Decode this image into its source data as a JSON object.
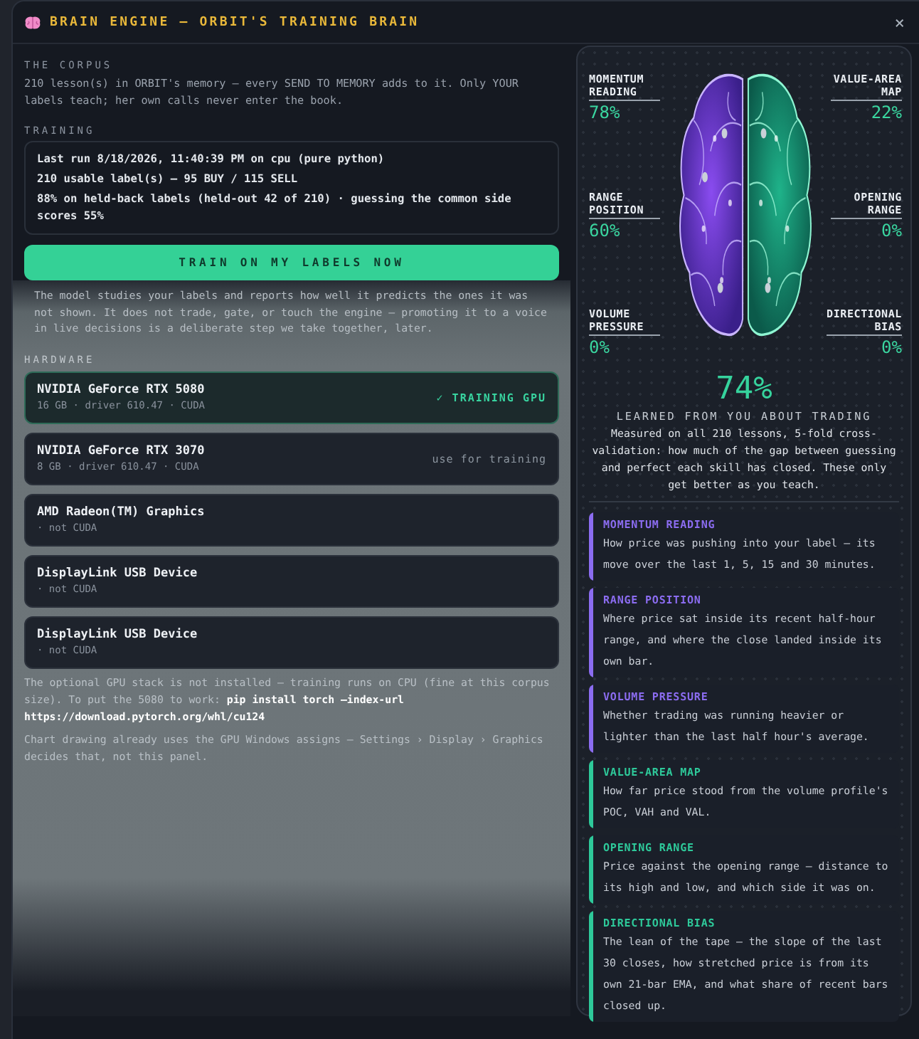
{
  "window": {
    "title": "BRAIN ENGINE — ORBIT'S TRAINING BRAIN",
    "close": "×"
  },
  "corpus": {
    "heading": "THE CORPUS",
    "text": "210 lesson(s) in ORBIT's memory — every SEND TO MEMORY adds to it. Only YOUR labels teach; her own calls never enter the book."
  },
  "training": {
    "heading": "TRAINING",
    "lines": [
      "Last run 8/18/2026, 11:40:39 PM on cpu (pure python)",
      "210 usable label(s) — 95 BUY / 115 SELL",
      "88% on held-back labels (held-out 42 of 210) · guessing the common side scores 55%"
    ],
    "button": "TRAIN ON MY LABELS NOW",
    "note": "The model studies your labels and reports how well it predicts the ones it was not shown. It does not trade, gate, or touch the engine — promoting it to a voice in live decisions is a deliberate step we take together, later."
  },
  "hardware": {
    "heading": "HARDWARE",
    "devices": [
      {
        "name": "NVIDIA GeForce RTX 5080",
        "detail": "16 GB · driver 610.47 · CUDA",
        "action": "✓ TRAINING GPU",
        "selected": true
      },
      {
        "name": "NVIDIA GeForce RTX 3070",
        "detail": "8 GB · driver 610.47 · CUDA",
        "action": "use for training",
        "selected": false
      },
      {
        "name": "AMD Radeon(TM) Graphics",
        "detail": "· not CUDA",
        "selected": false
      },
      {
        "name": "DisplayLink USB Device",
        "detail": "· not CUDA",
        "selected": false
      },
      {
        "name": "DisplayLink USB Device",
        "detail": "· not CUDA",
        "selected": false
      }
    ],
    "note": "The optional GPU stack is not installed — training runs on CPU (fine at this corpus size). To put the 5080 to work: **pip install torch —index-url https://download.pytorch.org/whl/cu124**",
    "note_2": "Chart drawing already uses the GPU Windows assigns — Settings › Display › Graphics decides that, not this panel."
  },
  "brain": {
    "regions": [
      {
        "name": "MOMENTUM READING",
        "reading": "78%"
      },
      {
        "name": "VALUE-AREA MAP",
        "reading": "22%"
      },
      {
        "name": "RANGE POSITION",
        "reading": "60%"
      },
      {
        "name": "OPENING RANGE",
        "reading": "0%"
      },
      {
        "name": "VOLUME PRESSURE",
        "reading": "0%"
      },
      {
        "name": "DIRECTIONAL BIAS",
        "reading": "0%"
      }
    ]
  },
  "score": {
    "value": "74%",
    "label": "LEARNED FROM YOU ABOUT TRADING",
    "text": "Measured on all 210 lessons, 5-fold cross-validation: how much of the gap between guessing and perfect each skill has closed. These only get better as you teach."
  },
  "skills": [
    {
      "title": "MOMENTUM READING",
      "text": "How price was pushing into your label — its move over the last 1, 5, 15 and 30 minutes.",
      "color": "#8b6cf0"
    },
    {
      "title": "RANGE POSITION",
      "text": "Where price sat inside its recent half-hour range, and where the close landed inside its own bar.",
      "color": "#8b6cf0"
    },
    {
      "title": "VOLUME PRESSURE",
      "text": "Whether trading was running heavier or lighter than the last half hour's average.",
      "color": "#8b6cf0"
    },
    {
      "title": "VALUE-AREA MAP",
      "text": "How far price stood from the volume profile's POC, VAH and VAL.",
      "color": "#2ec99a"
    },
    {
      "title": "OPENING RANGE",
      "text": "Price against the opening range — distance to its high and low, and which side it was on.",
      "color": "#2ec99a"
    },
    {
      "title": "DIRECTIONAL BIAS",
      "text": "The lean of the tape — the slope of the last 30 closes, how stretched price is from its own 21-bar EMA, and what share of recent bars closed up.",
      "color": "#2ec99a"
    }
  ]
}
